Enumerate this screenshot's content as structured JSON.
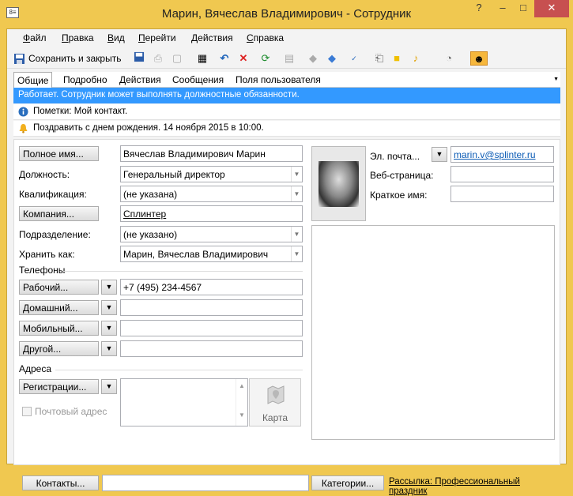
{
  "window": {
    "title": "Марин, Вячеслав Владимирович - Сотрудник",
    "help": "?",
    "minimize": "–",
    "maximize": "□",
    "close": "✕"
  },
  "menu": [
    "Файл",
    "Правка",
    "Вид",
    "Перейти",
    "Действия",
    "Справка"
  ],
  "toolbar": {
    "save_close": "Сохранить и закрыть"
  },
  "tabs": [
    "Общие",
    "Подробно",
    "Действия",
    "Сообщения",
    "Поля пользователя"
  ],
  "info": {
    "status": "Работает. Сотрудник может выполнять должностные обязанности.",
    "notes": "Пометки: Мой контакт.",
    "reminder": "Поздравить с днем рождения. 14 ноября 2015 в 10:00."
  },
  "form": {
    "full_name_btn": "Полное имя...",
    "full_name": "Вячеслав Владимирович Марин",
    "position_label": "Должность:",
    "position": "Генеральный директор",
    "qualification_label": "Квалификация:",
    "qualification": "(не указана)",
    "company_btn": "Компания...",
    "company": "Сплинтер",
    "department_label": "Подразделение:",
    "department": "(не указано)",
    "save_as_label": "Хранить как:",
    "save_as": "Марин, Вячеслав Владимирович",
    "phones_header": "Телефоны",
    "phone_work_btn": "Рабочий...",
    "phone_work": "+7 (495) 234-4567",
    "phone_home_btn": "Домашний...",
    "phone_mobile_btn": "Мобильный...",
    "phone_other_btn": "Другой...",
    "addresses_header": "Адреса",
    "address_btn": "Регистрации...",
    "postal_label": "Почтовый адрес",
    "map_label": "Карта",
    "email_label": "Эл. почта...",
    "email": "marin.v@splinter.ru",
    "web_label": "Веб-страница:",
    "short_name_label": "Краткое имя:",
    "contacts_btn": "Контакты...",
    "categories_btn": "Категории...",
    "mailing": "Рассылка: Профессиональный праздник"
  }
}
